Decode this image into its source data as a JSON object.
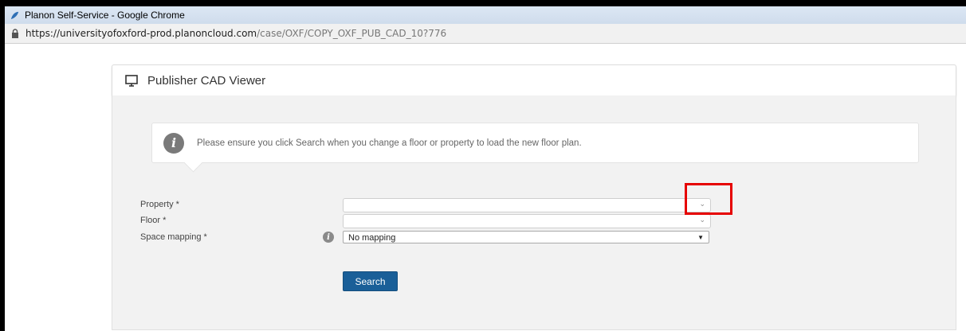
{
  "browser": {
    "title": "Planon Self-Service - Google Chrome",
    "url_host": "https://universityofoxford-prod.planoncloud.com",
    "url_path": "/case/OXF/COPY_OXF_PUB_CAD_10?776"
  },
  "panel": {
    "title": "Publisher CAD Viewer"
  },
  "info": {
    "message": "Please ensure you click Search when you change a floor or property to load the new floor plan."
  },
  "form": {
    "property_label": "Property *",
    "property_value": "",
    "floor_label": "Floor *",
    "floor_value": "",
    "space_mapping_label": "Space mapping *",
    "space_mapping_value": "No mapping",
    "search_label": "Search"
  },
  "icons": {
    "panel": "monitor-icon",
    "info": "info-icon",
    "lock": "lock-icon",
    "dropdown": "chevron-down-icon"
  },
  "colors": {
    "primary_button": "#1a5f98",
    "highlight": "#e60000"
  }
}
